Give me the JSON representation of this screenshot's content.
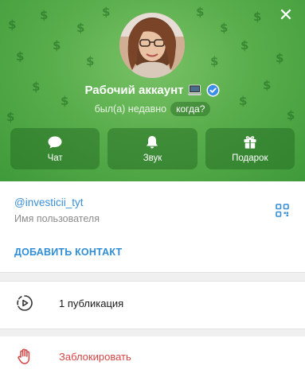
{
  "profile": {
    "name": "Рабочий аккаунт",
    "status": "был(а) недавно",
    "when_label": "когда?"
  },
  "actions": [
    {
      "label": "Чат",
      "icon": "chat-bubble-icon"
    },
    {
      "label": "Звук",
      "icon": "bell-icon"
    },
    {
      "label": "Подарок",
      "icon": "gift-icon"
    }
  ],
  "info": {
    "username": "@investicii_tyt",
    "username_caption": "Имя пользователя",
    "add_contact": "ДОБАВИТЬ КОНТАКТ"
  },
  "rows": {
    "publications": "1 публикация",
    "block": "Заблокировать"
  },
  "colors": {
    "header_green": "#5aae4c",
    "link_blue": "#3a8ed3",
    "danger_red": "#d64545",
    "verified_blue": "#3d8fe6"
  }
}
